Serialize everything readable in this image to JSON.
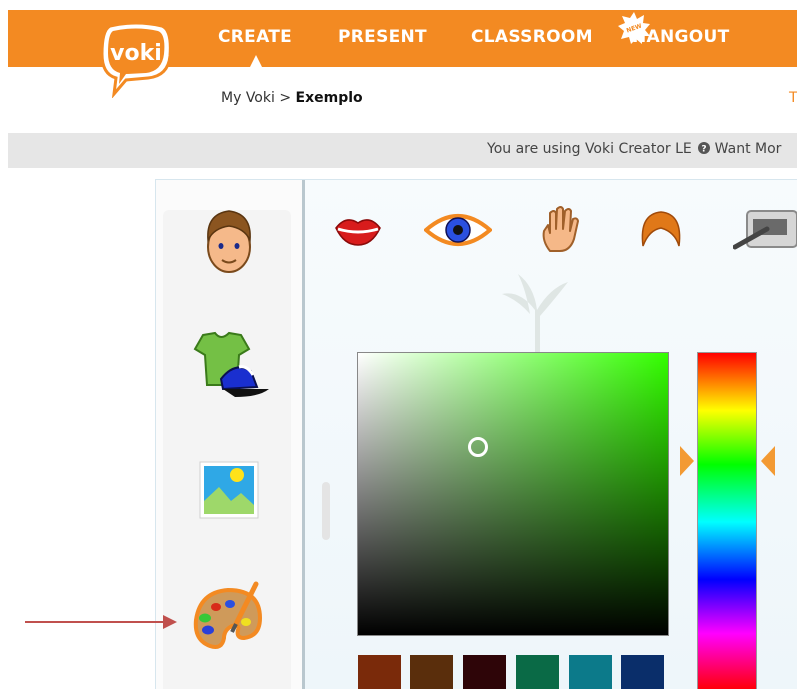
{
  "nav": {
    "items": [
      "CREATE",
      "PRESENT",
      "CLASSROOM",
      "HANGOUT"
    ],
    "active": "CREATE",
    "brand_color": "#f38a22",
    "logo_text": "voki",
    "new_badge": "NEW"
  },
  "breadcrumb": {
    "root": "My Voki",
    "separator": ">",
    "current": "Exemplo"
  },
  "info_bar": {
    "text": "You are using Voki Creator LE",
    "help_glyph": "?",
    "link_fragment": "Want Mor"
  },
  "sidebar": {
    "icons": [
      "head-icon",
      "clothing-icon",
      "background-icon",
      "color-palette-icon"
    ]
  },
  "toolbar": {
    "icons": [
      "mouth-icon",
      "eye-icon",
      "hand-icon",
      "hair-icon",
      "makeup-icon"
    ]
  },
  "color_picker": {
    "selected_hue": "#33ff00",
    "swatches": [
      "#7a2a0a",
      "#5a2e0c",
      "#2e0508",
      "#0a6a46",
      "#0c7a8a",
      "#0a2e6a"
    ]
  },
  "annotation": {
    "arrow_color": "#c0504d"
  }
}
